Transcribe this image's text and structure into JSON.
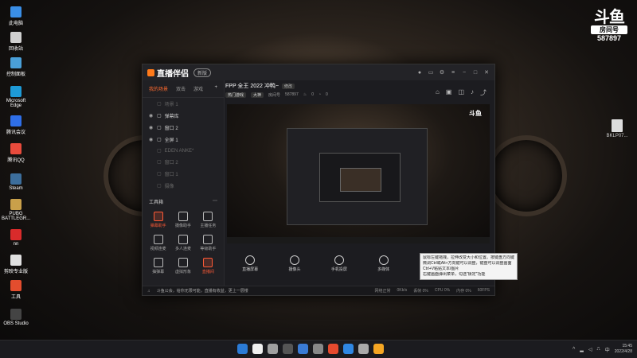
{
  "desktop": {
    "icons": [
      {
        "label": "此电脑",
        "color": "#3a8ee6"
      },
      {
        "label": "回收站",
        "color": "#d0d0d0"
      },
      {
        "label": "控制面板",
        "color": "#4a9fd8"
      },
      {
        "label": "Microsoft Edge",
        "color": "#1e9ad6"
      },
      {
        "label": "腾讯会议",
        "color": "#2f6fe8"
      },
      {
        "label": "腾讯QQ",
        "color": "#e84b3c"
      },
      {
        "label": "Steam",
        "color": "#3c6e9c"
      },
      {
        "label": "PUBG BATTLEGR...",
        "color": "#c9a04a"
      },
      {
        "label": "nn",
        "color": "#d92b2b"
      },
      {
        "label": "剪映专业版",
        "color": "#e0e0e0"
      },
      {
        "label": "工具",
        "color": "#e34d2e"
      },
      {
        "label": "OBS Studio",
        "color": "#444444"
      }
    ],
    "right_file": "BKLP07..."
  },
  "logo": {
    "main": "斗鱼",
    "room_label": "房间号",
    "room_number": "587897"
  },
  "app": {
    "title": "直播伴侣",
    "version": "新版",
    "tabs": [
      "我的场景",
      "双击",
      "游戏"
    ],
    "scenes": [
      {
        "label": "场景 1",
        "dim": true
      },
      {
        "label": "弹幕库",
        "dim": false
      },
      {
        "label": "窗口 2",
        "dim": false
      },
      {
        "label": "全屏 1",
        "dim": false
      },
      {
        "label": "EDEN ANKE*",
        "dim": true
      },
      {
        "label": "窗口 2",
        "dim": true
      },
      {
        "label": "窗口 1",
        "dim": true
      },
      {
        "label": "摄像",
        "dim": true
      }
    ],
    "tools_title": "工具箱",
    "tools": [
      {
        "label": "弹幕助手",
        "hot": true
      },
      {
        "label": "摄像助手",
        "hot": false
      },
      {
        "label": "主播任务",
        "hot": false
      },
      {
        "label": "视频连麦",
        "hot": false
      },
      {
        "label": "多人连麦",
        "hot": false
      },
      {
        "label": "等级助手",
        "hot": false
      },
      {
        "label": "抽弹幕",
        "hot": false
      },
      {
        "label": "虚拟形象",
        "hot": false
      },
      {
        "label": "直播间",
        "hot": true
      }
    ],
    "stream_title": "FPP 全王 2022 冲鸭~",
    "edit_tag": "修改",
    "category_tag": "热门游戏",
    "sub_tag": "大神",
    "room_label": "房间号",
    "room_number": "587897",
    "likes": "0",
    "viewers": "0",
    "mini_logo": "斗鱼",
    "controls": [
      "直播屏幕",
      "摄像头",
      "手机投屏",
      "多媒体",
      "素材库",
      "扬声器"
    ],
    "notice": "斗鱼公会，给你无限可能，直播有收益，更上一层楼",
    "stats": [
      "网络正常",
      "0Kb/s",
      "丢帧 0%",
      "CPU 0%",
      "内存 0%",
      "60FPS"
    ]
  },
  "tooltip": [
    "鼠标左键拖拽，拉伸改变大小和位置。按键盘方向键",
    "微调Ctrl或Alt+方向键可以调整，键盘可以调整画面",
    "Ctrl+V粘贴文本/图片",
    "右键画面弹出菜单，勾选“锁定”功能"
  ],
  "taskbar": {
    "apps": [
      "#2b7bd6",
      "#f0f0f0",
      "#a0a0a0",
      "#555555",
      "#3a7bd5",
      "#888888",
      "#e64a2e",
      "#2f87e3",
      "#aaaaaa",
      "#f5a623"
    ],
    "time": "15:45",
    "date": "2022/4/28",
    "tray": "中"
  }
}
